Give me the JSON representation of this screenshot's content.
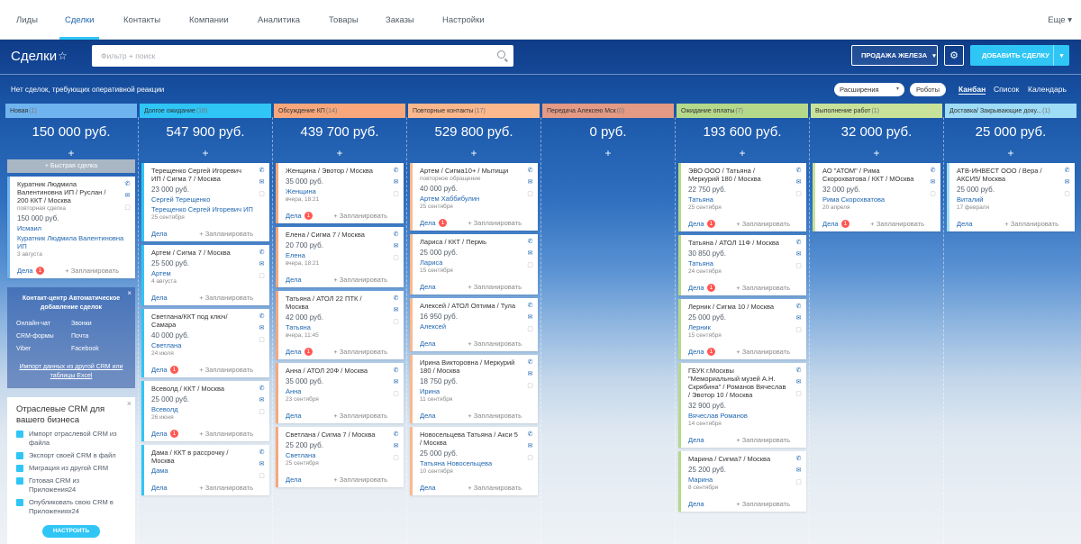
{
  "nav": {
    "items": [
      "Лиды",
      "Сделки",
      "Контакты",
      "Компании",
      "Аналитика",
      "Товары",
      "Заказы",
      "Настройки"
    ],
    "more": "Еще"
  },
  "header": {
    "title": "Сделки",
    "search_placeholder": "Фильтр + поиск",
    "pipeline_button": "ПРОДАЖА ЖЕЛЕЗА",
    "add_button": "ДОБАВИТЬ СДЕЛКУ"
  },
  "toolbar": {
    "info": "Нет сделок, требующих оперативной реакции",
    "extensions": "Расширения",
    "robots": "Роботы",
    "views": [
      "Канбан",
      "Список",
      "Календарь"
    ]
  },
  "colors": {
    "accent": "#2fc6f6",
    "link": "#2067b0",
    "badge": "#ff5752"
  },
  "card_labels": {
    "deals": "Дела",
    "plan": "+ Запланировать"
  },
  "quick_deal": "+ Быстрая сделка",
  "widget_contact": {
    "title": "Контакт-центр Автоматическое добавление сделок",
    "items": [
      "Онлайн-чат",
      "Звонки",
      "CRM-формы",
      "Почта",
      "Viber",
      "Facebook"
    ],
    "import": "Импорт данных из другой CRM или таблицы Excel"
  },
  "widget_industry": {
    "title": "Отраслевые CRM для вашего бизнеса",
    "items": [
      "Импорт отраслевой CRM из файла",
      "Экспорт своей CRM в файл",
      "Миграция из другой CRM",
      "Готовая CRM из Приложения24",
      "Опубликовать свою CRM в Приложениях24"
    ],
    "button": "НАСТРОИТЬ"
  },
  "columns": [
    {
      "name": "Новая",
      "count": "(1)",
      "sum": "150 000 руб.",
      "color": "#6fb4ef",
      "cards": [
        {
          "name": "Кура тник Людмила Валентиновна ИП / Руслан / 200 ККТ / Москва",
          "sub": "повторная сделка",
          "price": "150 000 руб.",
          "links": [
            "Исмаил",
            "Куратник Людмила Валентиновна ИП"
          ],
          "date": "3 августа",
          "badge": "1"
        }
      ]
    },
    {
      "name": "Долгое ожидание",
      "count": "(18)",
      "sum": "547 900 руб.",
      "color": "#2fc6f6",
      "cards": [
        {
          "name": "Терещенко Сергей Игоревич ИП / Сигма 7 / Москва",
          "price": "23 000 руб.",
          "links": [
            "Сергей Терещенко",
            "Терещенко Сергей Игоревич ИП"
          ],
          "date": "25 сентября",
          "badge": ""
        },
        {
          "name": "Артем / Сигма 7 / Москва",
          "price": "25 500 руб.",
          "links": [
            "Артем"
          ],
          "date": "4 августа",
          "badge": ""
        },
        {
          "name": "Светлана/ККТ под ключ/ Самара",
          "price": "40 000 руб.",
          "links": [
            "Светлана"
          ],
          "date": "24 июля",
          "badge": "1"
        },
        {
          "name": "Всеволд / ККТ / Москва",
          "price": "25 000 руб.",
          "links": [
            "Всеволд"
          ],
          "date": "26 июня",
          "badge": "1"
        },
        {
          "name": "Дама / ККТ в рассрочку / Москва",
          "price": "",
          "links": [
            "Дама"
          ],
          "date": "",
          "badge": ""
        }
      ]
    },
    {
      "name": "Обсуждение КП",
      "count": "(14)",
      "sum": "439 700 руб.",
      "color": "#f7a77b",
      "cards": [
        {
          "name": "Женщина / Эвотор / Москва",
          "price": "35 000 руб.",
          "links": [
            "Женщина"
          ],
          "date": "вчера, 18:21",
          "badge": "1"
        },
        {
          "name": "Елена / Сигма 7 / Москва",
          "price": "20 700 руб.",
          "links": [
            "Елена"
          ],
          "date": "вчера, 18:21",
          "badge": ""
        },
        {
          "name": "Татьяна / АТОЛ 22 ПТК / Москва",
          "price": "42 000 руб.",
          "links": [
            "Татьяна"
          ],
          "date": "вчера, 11:45",
          "badge": "1"
        },
        {
          "name": "Анна / АТОЛ 20Ф / Москва",
          "price": "35 000 руб.",
          "links": [
            "Анна"
          ],
          "date": "23 сентября",
          "badge": ""
        },
        {
          "name": "Светлана / Сигма 7 / Москва",
          "price": "25 200 руб.",
          "links": [
            "Светлана"
          ],
          "date": "25 сентября",
          "badge": ""
        }
      ]
    },
    {
      "name": "Повторные контакты",
      "count": "(17)",
      "sum": "529 800 руб.",
      "color": "#fbb88d",
      "cards": [
        {
          "name": "Артем / Сигма10+ / Мытищи",
          "sub": "повторное обращение",
          "price": "40 000 руб.",
          "links": [
            "Артем Хаббибулин"
          ],
          "date": "25 сентября",
          "badge": "1"
        },
        {
          "name": "Лариса / ККТ / Пермь",
          "price": "25 000 руб.",
          "links": [
            "Лариса"
          ],
          "date": "15 сентября",
          "badge": ""
        },
        {
          "name": "Алексей / АТОЛ Оптима / Тула",
          "price": "16 950 руб.",
          "links": [
            "Алексей"
          ],
          "date": "",
          "badge": ""
        },
        {
          "name": "Ирина Викторовна / Меркурий 180 / Москва",
          "price": "18 750 руб.",
          "links": [
            "Ирина"
          ],
          "date": "11 сентября",
          "badge": ""
        },
        {
          "name": "Новосельцева Татьяна / Акси 5 / Москва",
          "price": "25 000 руб.",
          "links": [
            "Татьяна Новосельцева"
          ],
          "date": "10 сентября",
          "badge": ""
        }
      ]
    },
    {
      "name": "Передача Алексею Мск",
      "count": "(0)",
      "sum": "0 руб.",
      "color": "#e49a85",
      "cards": []
    },
    {
      "name": "Ожидание оплаты",
      "count": "(7)",
      "sum": "193 600 руб.",
      "color": "#b5d98a",
      "cards": [
        {
          "name": "ЭВО ООО / Татьяна / Меркурий 180 / Москва",
          "price": "22 750 руб.",
          "links": [
            "Татьяна"
          ],
          "date": "25 сентября",
          "badge": "1"
        },
        {
          "name": "Татьяна / АТОЛ 11Ф / Москва",
          "price": "30 850 руб.",
          "links": [
            "Татьяна"
          ],
          "date": "24 сентября",
          "badge": "1"
        },
        {
          "name": "Лерник / Сигма 10 / Москва",
          "price": "25 000 руб.",
          "links": [
            "Лерник"
          ],
          "date": "15 сентября",
          "badge": "1"
        },
        {
          "name": "ГБУК г.Москвы \"Мемориальный музей А.Н. Скрябина\" / Романов Вячеслав / Эвотор 10 / Москва",
          "price": "32 900 руб.",
          "links": [
            "Вячеслав Романов"
          ],
          "date": "14 сентября",
          "badge": ""
        },
        {
          "name": "Марина / Сигма7 / Москва",
          "price": "25 200 руб.",
          "links": [
            "Марина"
          ],
          "date": "8 сентября",
          "badge": ""
        }
      ]
    },
    {
      "name": "Выполнение работ",
      "count": "(1)",
      "sum": "32 000 руб.",
      "color": "#c8e29a",
      "cards": [
        {
          "name": "АО \"АТОМ\" / Рима Скорохватова / ККТ / МОсква",
          "price": "32 000 руб.",
          "links": [
            "Рима Скорохватова"
          ],
          "date": "20 апреля",
          "badge": "1"
        }
      ]
    },
    {
      "name": "Доставка/ Закрывающие доку...",
      "count": "(1)",
      "sum": "25 000 руб.",
      "color": "#9fdcf5",
      "cards": [
        {
          "name": "АТВ-ИНВЕСТ ООО / Вера / АКСИ5/ Москва",
          "price": "25 000 руб.",
          "links": [
            "Виталий"
          ],
          "date": "17 февраля",
          "badge": ""
        }
      ]
    }
  ]
}
